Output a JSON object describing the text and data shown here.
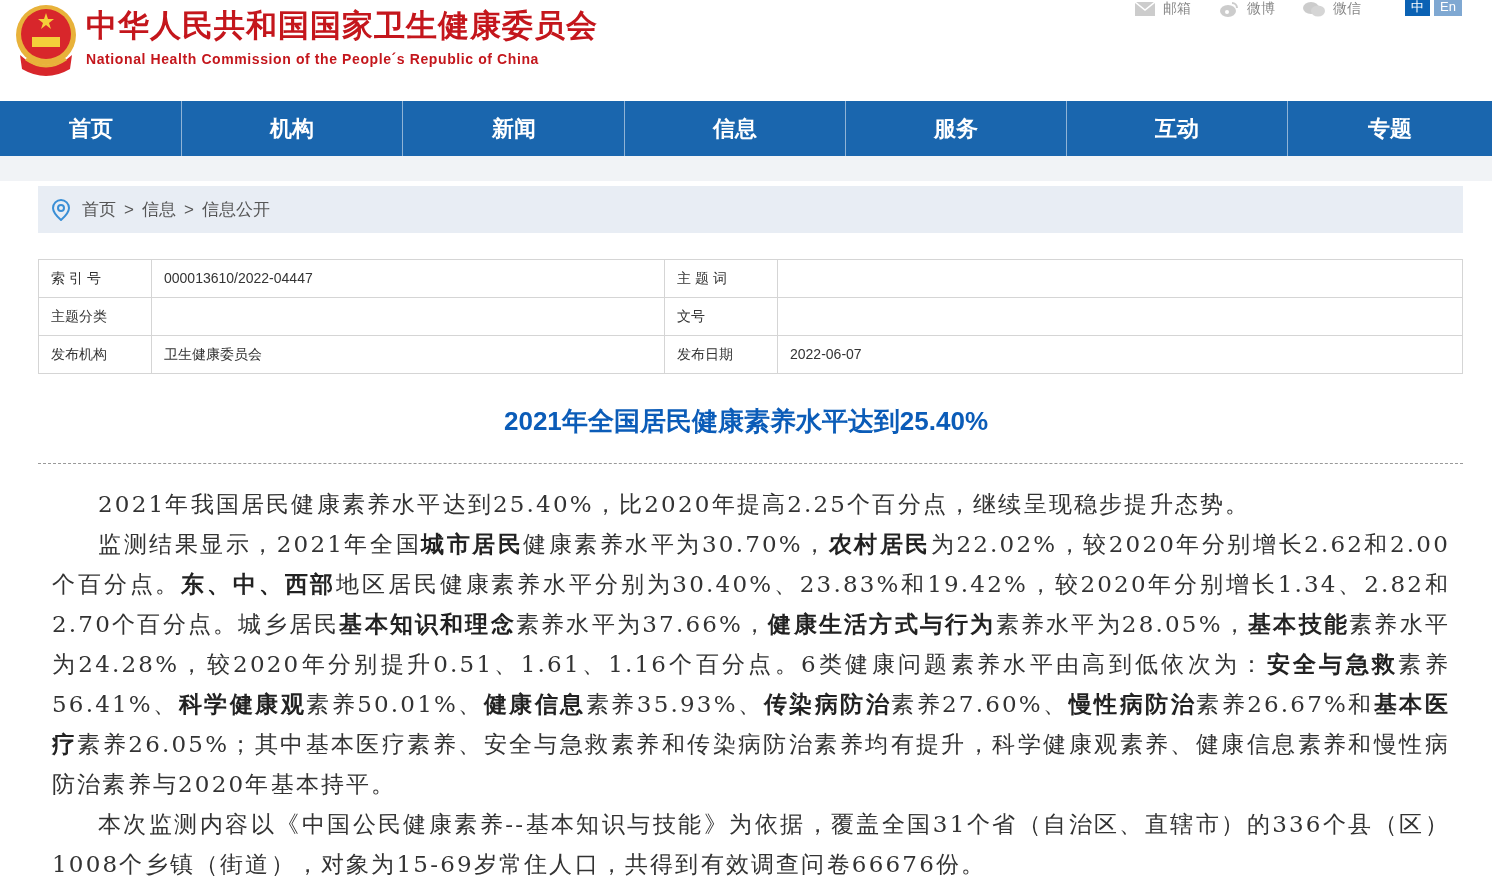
{
  "header": {
    "title_cn": "中华人民共和国国家卫生健康委员会",
    "title_en": "National Health Commission of the People´s Republic of China",
    "links": [
      {
        "label": "邮箱",
        "kind": "mail"
      },
      {
        "label": "微博",
        "kind": "weibo"
      },
      {
        "label": "微信",
        "kind": "wechat"
      }
    ],
    "languages": [
      {
        "label": "中",
        "selected": true
      },
      {
        "label": "En",
        "selected": false
      }
    ]
  },
  "nav": [
    {
      "label": "首页"
    },
    {
      "label": "机构"
    },
    {
      "label": "新闻"
    },
    {
      "label": "信息"
    },
    {
      "label": "服务"
    },
    {
      "label": "互动"
    },
    {
      "label": "专题"
    }
  ],
  "breadcrumb": {
    "separator": ">",
    "items": [
      "首页",
      "信息",
      "信息公开"
    ]
  },
  "meta_table": [
    [
      {
        "label": "索 引 号",
        "value": "000013610/2022-04447"
      },
      {
        "label": "主 题 词"
      }
    ],
    [
      {
        "label": "主题分类"
      },
      {
        "label": "文号"
      }
    ],
    [
      {
        "label": "发布机构",
        "value": "卫生健康委员会"
      },
      {
        "label": "发布日期",
        "value": "2022-06-07"
      }
    ]
  ],
  "article": {
    "title": "2021年全国居民健康素养水平达到25.40%",
    "paragraphs": [
      "2021年我国居民健康素养水平达到25.40%，比2020年提高2.25个百分点，继续呈现稳步提升态势。",
      "监测结果显示，2021年全国**城市居民**健康素养水平为30.70%，**农村居民**为22.02%，较2020年分别增长2.62和2.00个百分点。**东、中、西部**地区居民健康素养水平分别为30.40%、23.83%和19.42%，较2020年分别增长1.34、2.82和2.70个百分点。城乡居民**基本知识和理念**素养水平为37.66%，**健康生活方式与行为**素养水平为28.05%，**基本技能**素养水平为24.28%，较2020年分别提升0.51、1.61、1.16个百分点。6类健康问题素养水平由高到低依次为：**安全与急救**素养56.41%、**科学健康观**素养50.01%、**健康信息**素养35.93%、**传染病防治**素养27.60%、**慢性病防治**素养26.67%和**基本医疗**素养26.05%；其中基本医疗素养、安全与急救素养和传染病防治素养均有提升，科学健康观素养、健康信息素养和慢性病防治素养与2020年基本持平。",
      "本次监测内容以《中国公民健康素养--基本知识与技能》为依据，覆盖全国31个省（自治区、直辖市）的336个县（区）1008个乡镇（街道），对象为15-69岁常住人口，共得到有效调查问卷66676份。"
    ]
  }
}
